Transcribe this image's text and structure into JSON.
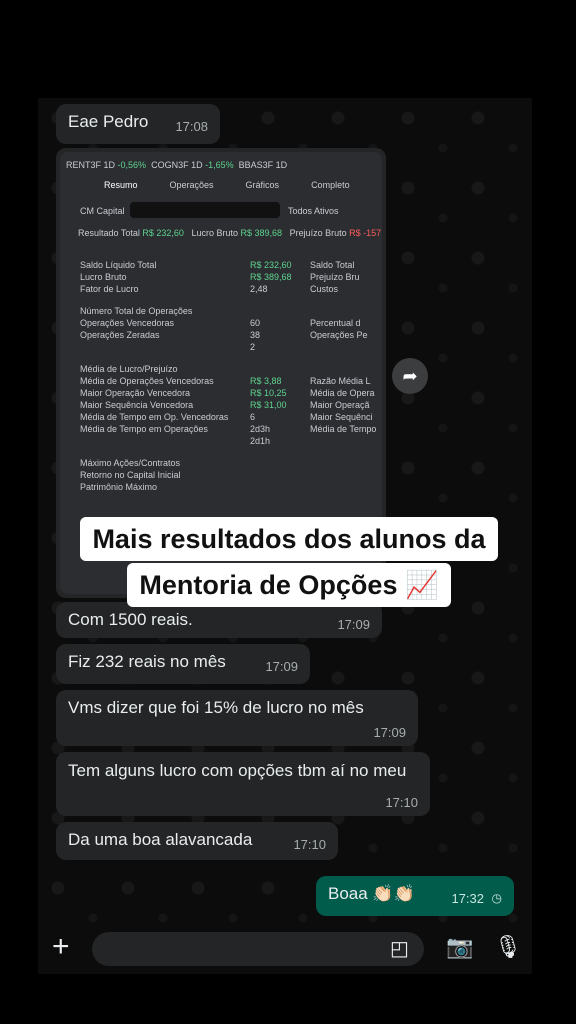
{
  "messages": [
    {
      "text": "Eae Pedro",
      "time": "17:08"
    },
    {
      "text": "Com 1500 reais.",
      "time": "17:09"
    },
    {
      "text": "Fiz 232 reais no mês",
      "time": "17:09"
    },
    {
      "text": "Vms dizer que foi 15% de lucro no mês",
      "time": "17:09"
    },
    {
      "text": "Tem alguns lucro com opções tbm aí no meu",
      "time": "17:10"
    },
    {
      "text": "Da uma boa alavancada",
      "time": "17:10"
    },
    {
      "text": "Boaa 👏🏻👏🏻",
      "time": "17:32"
    }
  ],
  "caption": {
    "line1": "Mais resultados dos alunos da",
    "line2": "Mentoria de Opções 📈"
  },
  "shot": {
    "tickers": [
      "RENT3F 1D",
      "-0,56%",
      "COGN3F 1D",
      "-1,65%",
      "BBAS3F 1D"
    ],
    "tabs": [
      "Resumo",
      "Operações",
      "Gráficos",
      "Completo"
    ],
    "account": "CM Capital",
    "filter": "Todos Ativos",
    "summary": {
      "r1": "Resultado Total",
      "r1v": "R$ 232,60",
      "r2": "Lucro Bruto",
      "r2v": "R$ 389,68",
      "r3": "Prejuízo Bruto",
      "r3v": "R$ -157,0"
    },
    "lines": [
      [
        "Saldo Líquido Total",
        "R$ 232,60",
        "Saldo Total"
      ],
      [
        "Lucro Bruto",
        "R$ 389,68",
        "Prejuízo Bru"
      ],
      [
        "Fator de Lucro",
        "2,48",
        "Custos"
      ],
      [
        "Número Total de Operações",
        "",
        ""
      ],
      [
        "Operações Vencedoras",
        "60",
        "Percentual d"
      ],
      [
        "Operações Zeradas",
        "38",
        "Operações Pe"
      ],
      [
        "",
        "2",
        ""
      ],
      [
        "Média de Lucro/Prejuízo",
        "",
        ""
      ],
      [
        "Média de Operações Vencedoras",
        "R$ 3,88",
        "Razão Média L"
      ],
      [
        "Maior Operação Vencedora",
        "R$ 10,25",
        "Média de Opera"
      ],
      [
        "Maior Sequência Vencedora",
        "R$ 31,00",
        "Maior Operaçã"
      ],
      [
        "Média de Tempo em Op. Vencedoras",
        "6",
        "Maior Sequênci"
      ],
      [
        "Média de Tempo em Operações",
        "2d3h",
        "Média de Tempo"
      ],
      [
        "",
        "2d1h",
        ""
      ],
      [
        "Máximo Ações/Contratos",
        "",
        ""
      ],
      [
        "Retorno no Capital Inicial",
        "",
        ""
      ],
      [
        "Patrimônio Máximo",
        "",
        ""
      ]
    ]
  }
}
